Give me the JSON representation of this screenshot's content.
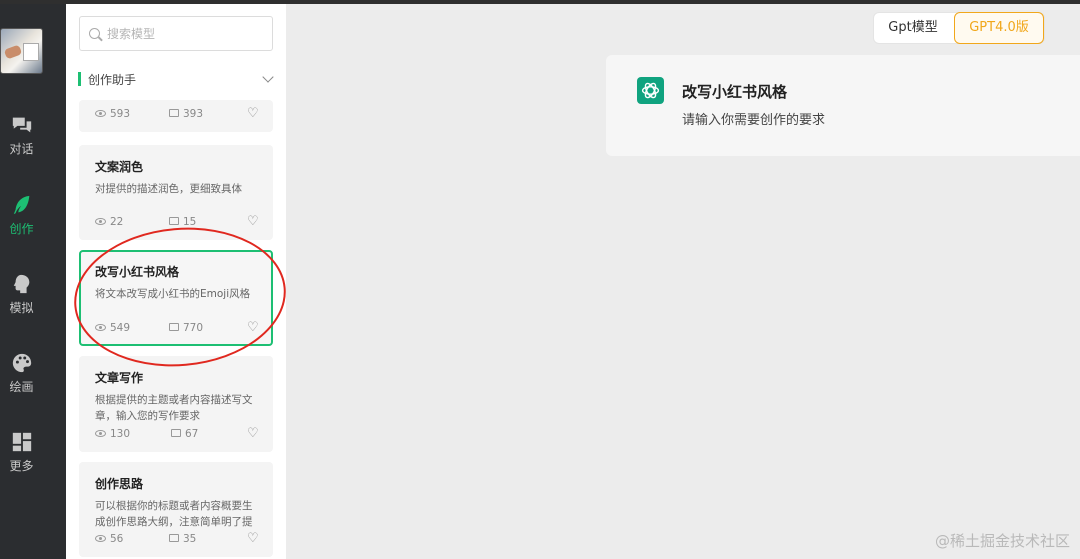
{
  "nav": {
    "items": [
      {
        "label": "对话",
        "icon": "chat-icon"
      },
      {
        "label": "创作",
        "icon": "feather-icon",
        "active": true
      },
      {
        "label": "模拟",
        "icon": "head-icon"
      },
      {
        "label": "绘画",
        "icon": "palette-icon"
      },
      {
        "label": "更多",
        "icon": "grid-icon"
      }
    ]
  },
  "search": {
    "placeholder": "搜索模型"
  },
  "section": {
    "title": "创作助手"
  },
  "cards": [
    {
      "title": "",
      "desc": "",
      "views": "593",
      "comments": "393"
    },
    {
      "title": "文案润色",
      "desc": "对提供的描述润色，更细致具体",
      "views": "22",
      "comments": "15"
    },
    {
      "title": "改写小红书风格",
      "desc": "将文本改写成小红书的Emoji风格",
      "views": "549",
      "comments": "770"
    },
    {
      "title": "文章写作",
      "desc": "根据提供的主题或者内容描述写文章，输入您的写作要求",
      "views": "130",
      "comments": "67"
    },
    {
      "title": "创作思路",
      "desc": "可以根据你的标题或者内容概要生成创作思路大纲，注意简单明了提",
      "views": "56",
      "comments": "35"
    }
  ],
  "model_toggle": {
    "option1": "Gpt模型",
    "option2": "GPT4.0版"
  },
  "prompt": {
    "title": "改写小红书风格",
    "subtitle": "请输入你需要创作的要求"
  },
  "watermark": "@稀土掘金技术社区",
  "colors": {
    "accent": "#1dbf73",
    "gpt4": "#f1a71b",
    "annotation": "#e0281f"
  }
}
